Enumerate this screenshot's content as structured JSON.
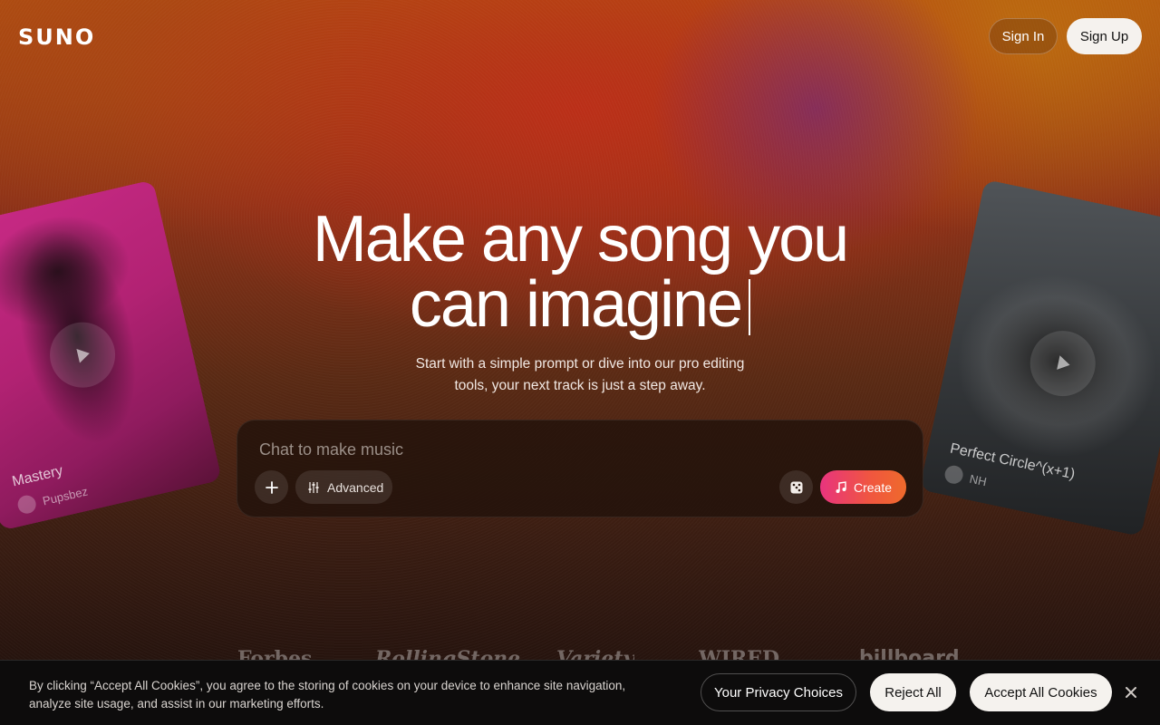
{
  "brand": {
    "logo_text": "SUNO"
  },
  "header": {
    "signin_label": "Sign In",
    "signup_label": "Sign Up"
  },
  "hero": {
    "title_line1": "Make any song you",
    "title_line2": "can imagine",
    "subtitle": "Start with a simple prompt or dive into our pro editing tools, your next track is just a step away."
  },
  "prompt": {
    "placeholder": "Chat to make music",
    "add_icon": "plus-icon",
    "advanced_label": "Advanced",
    "advanced_icon": "sliders-icon",
    "dice_icon": "dice-icon",
    "create_label": "Create",
    "create_icon": "music-note-icon"
  },
  "cards": [
    {
      "title": "Mastery",
      "artist": "Pupsbez",
      "icon": "play-icon"
    },
    {
      "title": "Perfect Circle^(x+1)",
      "artist": "NH",
      "icon": "play-icon"
    }
  ],
  "press": [
    "Forbes",
    "RollingStone",
    "Variety",
    "WIRED",
    "billboard"
  ],
  "cookie": {
    "text": "By clicking “Accept All Cookies”, you agree to the storing of cookies on your device to enhance site navigation, analyze site usage, and assist in our marketing efforts.",
    "privacy_label": "Your Privacy Choices",
    "reject_label": "Reject All",
    "accept_label": "Accept All Cookies",
    "close_icon": "close-icon"
  },
  "colors": {
    "accent_gradient_start": "#e8347e",
    "accent_gradient_end": "#ef6a2c",
    "button_light": "#f5f2ee",
    "banner_bg": "#0d0c0c"
  }
}
